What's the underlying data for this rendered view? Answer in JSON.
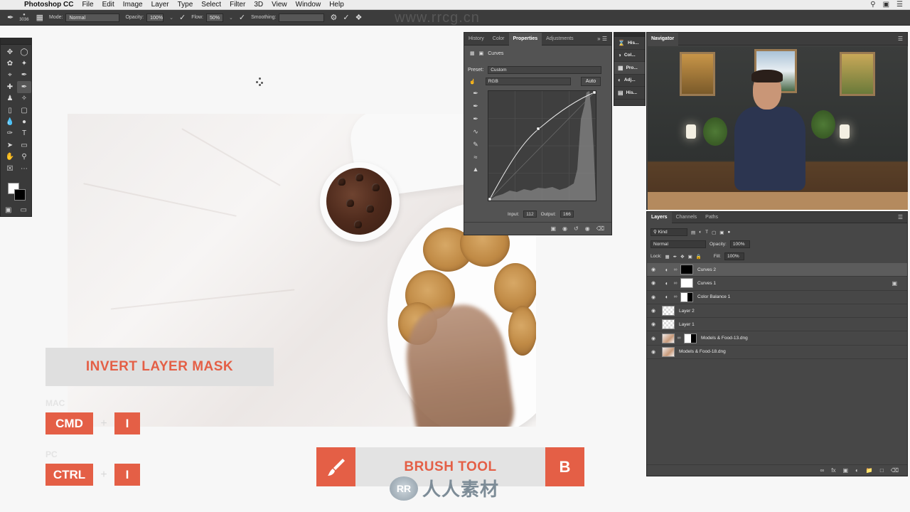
{
  "menubar": {
    "app": "Photoshop CC",
    "items": [
      "File",
      "Edit",
      "Image",
      "Layer",
      "Type",
      "Select",
      "Filter",
      "3D",
      "View",
      "Window",
      "Help"
    ]
  },
  "options_bar": {
    "brush_size": "3036",
    "mode_label": "Mode:",
    "mode_value": "Normal",
    "opacity_label": "Opacity:",
    "opacity_value": "100%",
    "flow_label": "Flow:",
    "flow_value": "50%",
    "smoothing_label": "Smoothing:"
  },
  "watermark": "www.rrcg.cn",
  "properties_panel": {
    "tabs": [
      "History",
      "Color",
      "Properties",
      "Adjustments"
    ],
    "active_tab": "Properties",
    "title": "Curves",
    "preset_label": "Preset:",
    "preset_value": "Custom",
    "channel": "RGB",
    "auto_label": "Auto",
    "input_label": "Input:",
    "input_value": "112",
    "output_label": "Output:",
    "output_value": "166"
  },
  "mini_dock": {
    "items": [
      {
        "label": "His...",
        "icon": "history-icon"
      },
      {
        "label": "Col...",
        "icon": "color-icon"
      },
      {
        "label": "Pro...",
        "icon": "properties-icon"
      },
      {
        "label": "Adj...",
        "icon": "adjustments-icon"
      },
      {
        "label": "His...",
        "icon": "histogram-icon"
      }
    ]
  },
  "navigator": {
    "title": "Navigator"
  },
  "layers_panel": {
    "tabs": [
      "Layers",
      "Channels",
      "Paths"
    ],
    "filter_label": "Kind",
    "blend_mode": "Normal",
    "opacity_label": "Opacity:",
    "opacity_value": "100%",
    "lock_label": "Lock:",
    "fill_label": "Fill:",
    "fill_value": "100%",
    "layers": [
      {
        "name": "Curves 2",
        "type": "adjustment",
        "mask": "black",
        "selected": true
      },
      {
        "name": "Curves 1",
        "type": "adjustment",
        "mask": "white",
        "selected": false
      },
      {
        "name": "Color Balance 1",
        "type": "adjustment",
        "mask": "half",
        "selected": false
      },
      {
        "name": "Layer 2",
        "type": "pixel",
        "mask": "none",
        "selected": false
      },
      {
        "name": "Layer 1",
        "type": "pixel",
        "mask": "none",
        "selected": false
      },
      {
        "name": "Models & Food-13.dng",
        "type": "photo",
        "mask": "half",
        "selected": false
      },
      {
        "name": "Models & Food-18.dng",
        "type": "photo",
        "mask": "none",
        "selected": false
      }
    ]
  },
  "overlay": {
    "invert_title": "INVERT LAYER MASK",
    "mac_label": "MAC",
    "pc_label": "PC",
    "mac_key1": "CMD",
    "mac_key2": "I",
    "pc_key1": "CTRL",
    "pc_key2": "I",
    "plus": "+",
    "brush_title": "BRUSH TOOL",
    "brush_key": "B"
  },
  "logo": {
    "mark": "RR",
    "name": "人人素材"
  },
  "colors": {
    "accent": "#e45f46",
    "panel_bg": "#535353",
    "panel_dark": "#3d3d3d"
  }
}
